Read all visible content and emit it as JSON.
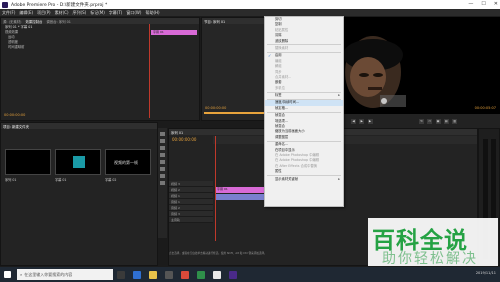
{
  "title_bar": {
    "title": "Adobe Premiere Pro - D:\\新建文件夹.prproj *",
    "minimize": "—",
    "maximize": "☐",
    "close": "✕"
  },
  "menu_bar": [
    "文件(F)",
    "编辑(E)",
    "项目(P)",
    "素材(C)",
    "序列(S)",
    "标记(M)",
    "字幕(T)",
    "窗口(W)",
    "帮助(H)"
  ],
  "effects_panel": {
    "tab": "源: (无素材)",
    "tab2": "效果控制台",
    "tab3": "调音台: 序列 01",
    "sequence_label": "序列 01 * 字幕 01",
    "rows": [
      "视频效果",
      "运动",
      "透明度",
      "时间重映射"
    ],
    "timecode": "00:00:00:00"
  },
  "program_monitor": {
    "tab": "节目: 序列 01",
    "timecode_left": "00:00:00:00",
    "timecode_right": "00:00:05:07"
  },
  "project_panel": {
    "tab": "项目: 新建文件夹",
    "clips": [
      "序列 01",
      "字幕 01",
      "字幕 02"
    ],
    "clip_text": "视频的第一帧"
  },
  "timeline": {
    "tab": "序列 01",
    "timecode": "00:00:00:00",
    "tracks": [
      "视频 3",
      "视频 2",
      "视频 1",
      "音频 1",
      "音频 2",
      "音频 3",
      "主音轨"
    ],
    "clip_label": "字幕 01",
    "status": "点击选择，或者在空白处单击拖动进行框选。使用 Shift、Alt 和 Ctrl 键来添加选择。"
  },
  "context_menu": {
    "items": [
      {
        "label": "剪切",
        "disabled": false
      },
      {
        "label": "复制",
        "disabled": false
      },
      {
        "label": "粘贴属性",
        "disabled": true
      },
      {
        "label": "清除",
        "disabled": false
      },
      {
        "label": "波纹删除",
        "disabled": false
      },
      {
        "sep": true
      },
      {
        "label": "替换素材",
        "disabled": true
      },
      {
        "sep": true
      },
      {
        "label": "启用",
        "disabled": false,
        "checked": true
      },
      {
        "label": "编组",
        "disabled": true
      },
      {
        "label": "解组",
        "disabled": true
      },
      {
        "label": "同步",
        "disabled": true
      },
      {
        "label": "合并素材...",
        "disabled": true
      },
      {
        "label": "嵌套",
        "disabled": false
      },
      {
        "label": "多机位",
        "disabled": true
      },
      {
        "sep": true
      },
      {
        "label": "标签",
        "disabled": false,
        "submenu": true
      },
      {
        "sep": true
      },
      {
        "label": "速度/持续时间...",
        "disabled": false
      },
      {
        "label": "帧定格...",
        "disabled": false
      },
      {
        "sep": true
      },
      {
        "label": "帧混合",
        "disabled": false
      },
      {
        "label": "场选项...",
        "disabled": false
      },
      {
        "label": "帧混合",
        "disabled": false
      },
      {
        "label": "缩放为当前画面大小",
        "disabled": false
      },
      {
        "label": "调整图层",
        "disabled": false
      },
      {
        "sep": true
      },
      {
        "label": "重命名...",
        "disabled": false
      },
      {
        "label": "在项目中显示",
        "disabled": false
      },
      {
        "label": "在 Adobe Photoshop 中编辑",
        "disabled": true
      },
      {
        "label": "在 Adobe Photoshop 中编辑",
        "disabled": true
      },
      {
        "label": "在 After Effects 合成中替换",
        "disabled": true
      },
      {
        "label": "属性",
        "disabled": false
      },
      {
        "sep": true
      },
      {
        "label": "显示素材关键帧",
        "disabled": false,
        "submenu": true
      }
    ]
  },
  "taskbar": {
    "search_placeholder": "在这里输入你要搜索的内容",
    "time": "2019/11/11"
  },
  "watermark": {
    "line1": "百科全说",
    "line2": "助你轻松解决"
  },
  "colors": {
    "accent_pink": "#d86ad6",
    "accent_green": "#25a244",
    "timecode_orange": "#e8a33c"
  }
}
